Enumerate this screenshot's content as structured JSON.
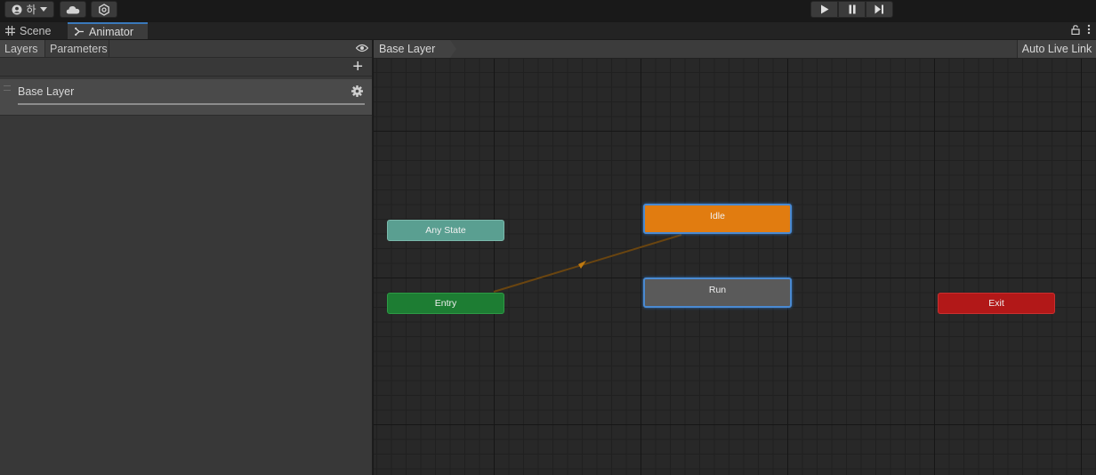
{
  "toolbar": {
    "account_label": "하",
    "icons": [
      "account-icon",
      "dropdown-icon",
      "cloud-icon",
      "collab-icon",
      "play-icon",
      "pause-icon",
      "step-icon"
    ]
  },
  "tabs": [
    {
      "label": "Scene",
      "icon": "grid-icon"
    },
    {
      "label": "Animator",
      "icon": "animator-icon"
    }
  ],
  "left_panel": {
    "tabs": [
      "Layers",
      "Parameters"
    ],
    "add_label": "+",
    "layers": [
      {
        "name": "Base Layer"
      }
    ]
  },
  "graph": {
    "breadcrumb": "Base Layer",
    "auto_live_link": "Auto Live Link",
    "states": {
      "any_state": "Any State",
      "entry": "Entry",
      "idle": "Idle",
      "run": "Run",
      "exit": "Exit"
    },
    "default_state": "Idle"
  },
  "colors": {
    "any_state": "#5a9f91",
    "entry": "#1d7d33",
    "default_state": "#e17c10",
    "state": "#5a5a5a",
    "exit": "#b21818",
    "selection": "#4a8ad2",
    "transition": "#8a5a10"
  }
}
